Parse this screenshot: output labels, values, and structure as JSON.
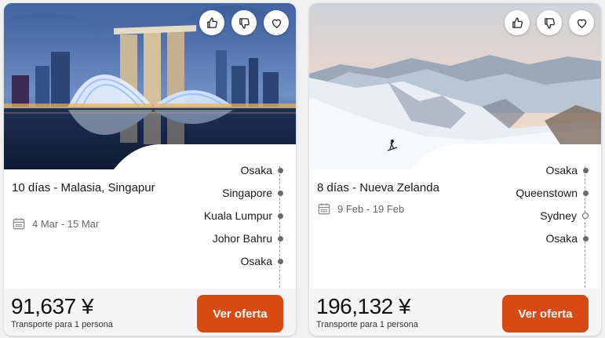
{
  "cards": [
    {
      "title": "10 días - Malasia, Singapur",
      "dates": "4 Mar - 15 Mar",
      "stops": [
        {
          "name": "Osaka",
          "dot": "filled"
        },
        {
          "name": "Singapore",
          "dot": "filled"
        },
        {
          "name": "Kuala Lumpur",
          "dot": "filled"
        },
        {
          "name": "Johor Bahru",
          "dot": "filled"
        },
        {
          "name": "Osaka",
          "dot": "filled"
        }
      ],
      "price": "91,637 ¥",
      "price_note": "Transporte para 1 persona",
      "cta_label": "Ver oferta",
      "image": "singapore-skyline-night"
    },
    {
      "title": "8 días - Nueva Zelanda",
      "dates": "9 Feb - 19 Feb",
      "stops": [
        {
          "name": "Osaka",
          "dot": "filled"
        },
        {
          "name": "Queenstown",
          "dot": "filled"
        },
        {
          "name": "Sydney",
          "dot": "hollow"
        },
        {
          "name": "Osaka",
          "dot": "filled"
        }
      ],
      "price": "196,132 ¥",
      "price_note": "Transporte para 1 persona",
      "cta_label": "Ver oferta",
      "image": "snowy-mountain-skier"
    }
  ],
  "icons": {
    "like": "thumbs-up-icon",
    "dislike": "thumbs-down-icon",
    "favorite": "heart-icon",
    "calendar": "calendar-icon"
  },
  "colors": {
    "accent": "#d94a13",
    "route_dot": "#6b6b6b"
  }
}
